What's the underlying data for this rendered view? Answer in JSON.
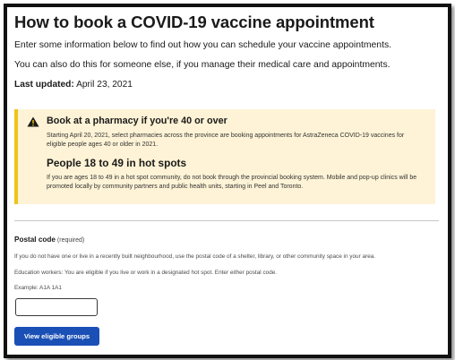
{
  "page": {
    "title": "How to book a COVID-19 vaccine appointment",
    "intro": "Enter some information below to find out how you can schedule your vaccine appointments.",
    "intro2": "You can also do this for someone else, if you manage their medical care and appointments.",
    "updated_label": "Last updated:",
    "updated_value": " April 23, 2021"
  },
  "alert": {
    "icon": "warning-icon",
    "heading1": "Book at a pharmacy if you're 40 or over",
    "text1": "Starting April 20, 2021, select pharmacies across the province are booking appointments for AstraZeneca COVID-19 vaccines for eligible people ages 40 or older in 2021.",
    "heading2": "People 18 to 49 in hot spots",
    "text2": "If you are ages 18 to 49 in a hot spot community, do not book through the provincial booking system. Mobile and pop-up clinics will be promoted locally by community partners and public health units, starting in Peel and Toronto.",
    "accent_color": "#f0c31a",
    "background_color": "#fef3d6"
  },
  "form": {
    "postal_label": "Postal code",
    "postal_required": " (required)",
    "hint1": "If you do not have one or live in a recently built neighbourhood, use the postal code of a shelter, library, or other community space in your area.",
    "hint2": "Education workers: You are eligible if you live or work in a designated hot spot. Enter either postal code.",
    "hint3": "Example: A1A 1A1",
    "postal_value": "",
    "button_label": "View eligible groups",
    "button_color": "#1a4fb5"
  }
}
